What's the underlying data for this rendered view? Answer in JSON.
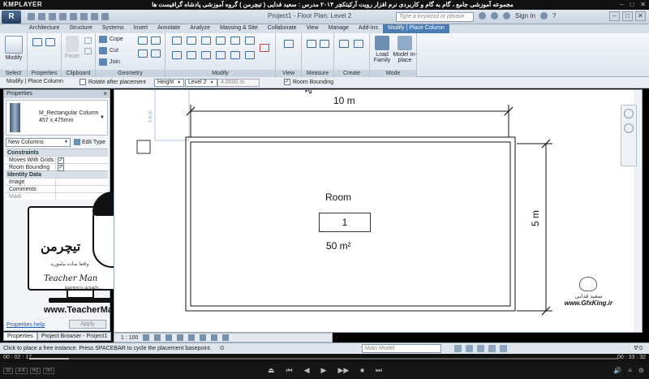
{
  "player": {
    "logo": "KMPLAYER",
    "title": "مجموعه آموزشی جامع ، گام به گام و کاربردی نرم افزار رویت آرکیتکچر ۲۰۱۴   مدرس : سعید فدایی ( تیچرمن ) گروه آموزشی پادشاه گرافیست ها",
    "win_controls": [
      "–",
      "□",
      "✕"
    ],
    "time_elapsed": "00 : 02 : 17",
    "time_total": "00 : 33 : 32",
    "progress": 0.068,
    "quality_tags": [
      "3D",
      "A-B",
      "HQ",
      "ON"
    ],
    "controls": [
      "⏏",
      "⏮",
      "◀",
      "▶",
      "▶▶",
      "⏹",
      "⏭"
    ],
    "right_controls": [
      "🔊",
      "≡",
      "⚙"
    ]
  },
  "revit": {
    "app_button": "R",
    "document_title": "Project1 - Floor Plan: Level 2",
    "search_placeholder": "Type a keyword or phrase",
    "sign_in": "Sign In",
    "help": "?"
  },
  "ribbon_tabs": [
    {
      "label": "Architecture",
      "active": false
    },
    {
      "label": "Structure",
      "active": false
    },
    {
      "label": "Systems",
      "active": false
    },
    {
      "label": "Insert",
      "active": false
    },
    {
      "label": "Annotate",
      "active": false
    },
    {
      "label": "Analyze",
      "active": false
    },
    {
      "label": "Massing & Site",
      "active": false
    },
    {
      "label": "Collaborate",
      "active": false
    },
    {
      "label": "View",
      "active": false
    },
    {
      "label": "Manage",
      "active": false
    },
    {
      "label": "Add-Ins",
      "active": false
    },
    {
      "label": "Modify | Place Column",
      "active": true
    }
  ],
  "ribbon": {
    "select": {
      "button": "Modify",
      "label": "Select"
    },
    "properties": {
      "label": "Properties"
    },
    "clipboard": {
      "paste": "Paste",
      "label": "Clipboard"
    },
    "geometry": {
      "cope": "Cope",
      "cut": "Cut",
      "join": "Join",
      "label": "Geometry"
    },
    "modify": {
      "label": "Modify"
    },
    "view": {
      "label": "View"
    },
    "measure": {
      "label": "Measure"
    },
    "create": {
      "label": "Create"
    },
    "mode": {
      "load_family": "Load Family",
      "model_inplace": "Model In-place",
      "label": "Mode"
    }
  },
  "options_bar": {
    "context": "Modify | Place Column",
    "rotate_after": "Rotate after placement",
    "rotate_checked": false,
    "height_mode": "Height",
    "level": "Level 2",
    "height_value": "4.0000 m",
    "room_bounding": "Room Bounding",
    "room_bounding_checked": true
  },
  "properties": {
    "title": "Properties",
    "family": "M_Rectangular Column",
    "type": "457 x 475mm",
    "instance_filter": "New Columns",
    "edit_type": "Edit Type",
    "groups": [
      {
        "name": "Constraints",
        "rows": [
          {
            "key": "Moves With Grids",
            "checked": true
          },
          {
            "key": "Room Bounding",
            "checked": true
          }
        ]
      },
      {
        "name": "Identity Data",
        "rows": [
          {
            "key": "Image",
            "checked": null
          },
          {
            "key": "Comments",
            "checked": null
          },
          {
            "key": "Mark",
            "checked": null
          }
        ]
      }
    ],
    "help_link": "Properties help",
    "apply": "Apply",
    "tabs": [
      "Properties",
      "Project Browser - Project1"
    ]
  },
  "watermark": {
    "brand_fa": "تیچرمن",
    "brand_sub": "واقعا ساده بیاموزید",
    "brand_en": "Teacher Man",
    "tagline": "learning is actually...",
    "url": "www.TeacherMan.ir",
    "gfx_name": "سعید فدایی",
    "gfx_site": "www.GfxKing.ir"
  },
  "drawing": {
    "dim_width": "10 m",
    "dim_height": "5 m",
    "pending_dim": "1.6 m",
    "room_name": "Room",
    "room_number": "1",
    "room_area": "50 m²"
  },
  "view_bar": {
    "scale": "1 : 100"
  },
  "status_bar": {
    "message": "Click to place a free instance. Press SPACEBAR to cycle the placement basepoint.",
    "zero": ":0",
    "model": "Main Model",
    "filter": "∇:0"
  }
}
